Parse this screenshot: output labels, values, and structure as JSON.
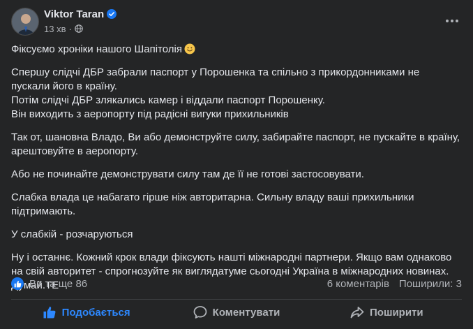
{
  "post": {
    "author": "Viktor Taran",
    "timestamp": "13 хв",
    "visibility_icon": "globe-icon",
    "verified_icon": "verified-badge-icon",
    "more_icon": "more-horizontal-icon",
    "paragraphs": [
      {
        "lines": [
          "Фіксуємо хроніки нашого Шапітолія"
        ],
        "emoji": "smiling-face-emoji"
      },
      {
        "lines": [
          "Спершу слідчі ДБР забрали паспорт у Порошенка та спільно з прикордонниками не",
          "пускали його в країну.",
          "Потім слідчі ДБР злякались камер і віддали паспорт Порошенку.",
          "Він виходить з аеропорту під радісні вигуки прихильників"
        ]
      },
      {
        "lines": [
          "Так от, шановна Владо, Ви або демонструйте силу, забирайте паспорт, не пускайте в країну,",
          "арештовуйте в аеропорту."
        ]
      },
      {
        "lines": [
          "Або не починайте демонструвати силу там де її не готові застосовувати."
        ]
      },
      {
        "lines": [
          "Слабка влада це набагато гірше ніж авторитарна. Сильну владу ваші прихильники",
          "підтримають."
        ]
      },
      {
        "lines": [
          "У слабкій - розчаруються"
        ]
      },
      {
        "lines": [
          "Ну і останнє. Кожний крок влади фіксують нашті міжнародні партнери. Якщо вам однаково",
          "на свій авторитет - спрогнозуйте як виглядатуме сьогодні Україна в міжнародних новинах.",
          "Думай.ТЕ"
        ]
      }
    ]
  },
  "stats": {
    "reactions_label": "Ви та ще 86",
    "comments_label": "6 коментарів",
    "shares_label": "Поширили: 3"
  },
  "actions": {
    "like_label": "Подобається",
    "comment_label": "Коментувати",
    "share_label": "Поширити"
  },
  "colors": {
    "background": "#242526",
    "text_primary": "#e4e6eb",
    "text_secondary": "#b0b3b8",
    "accent": "#2d88ff",
    "like_badge": "#1877f2"
  }
}
